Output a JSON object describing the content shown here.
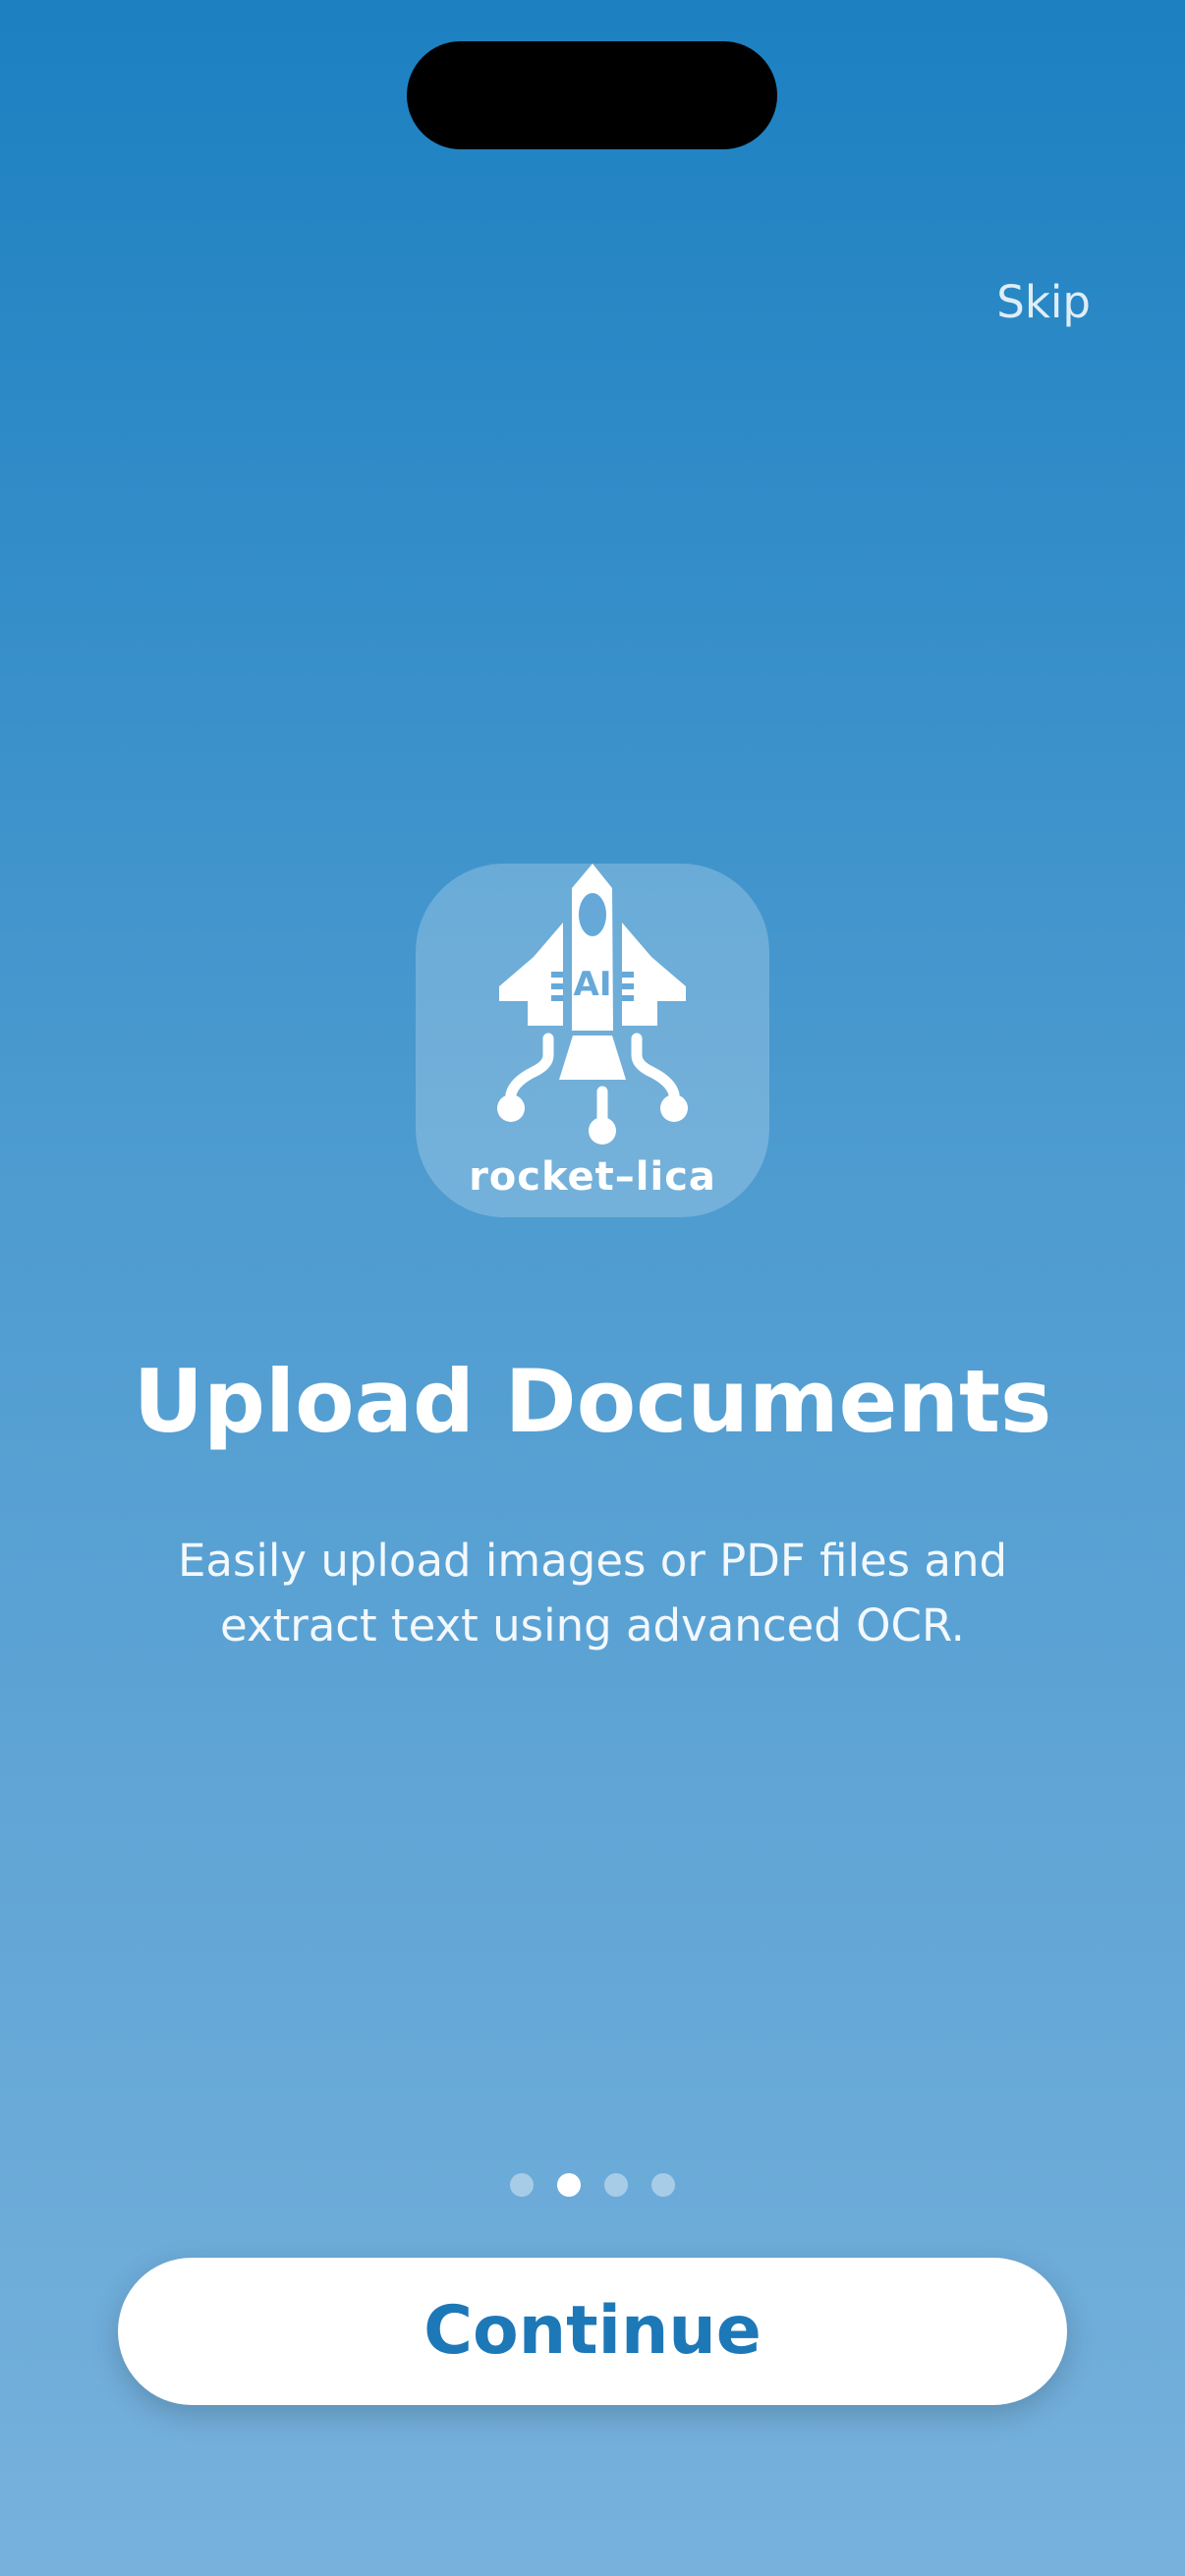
{
  "header": {
    "skip_label": "Skip"
  },
  "logo": {
    "badge_text": "AI",
    "wordmark": "rocket–lica"
  },
  "onboarding": {
    "title": "Upload Documents",
    "subtitle": "Easily upload images or PDF files and extract text using advanced OCR.",
    "current_page": 2,
    "total_pages": 4
  },
  "footer": {
    "continue_label": "Continue"
  },
  "colors": {
    "gradient_top": "#1c80c1",
    "gradient_bottom": "#77b1dc",
    "button_text": "#1d78b8"
  },
  "icons": [
    "rocket-icon"
  ]
}
